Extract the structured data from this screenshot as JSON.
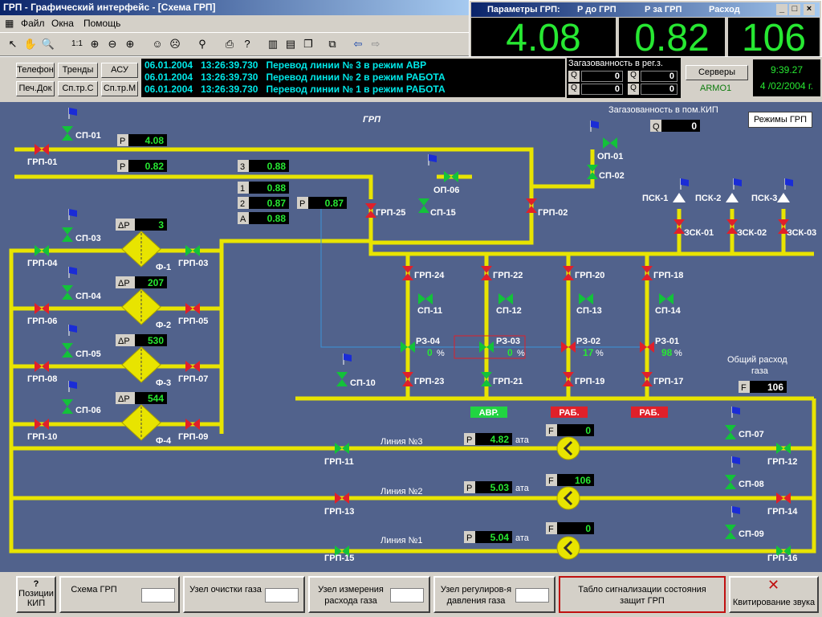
{
  "window": {
    "title": "ГРП - Графический интерфейс - [Схема ГРП]"
  },
  "menu": [
    "Файл",
    "Окна",
    "Помощь"
  ],
  "params_window": {
    "title": "Параметры ГРП:",
    "h1": "Р до ГРП",
    "h2": "Р за ГРП",
    "h3": "Расход",
    "v1": "4.08",
    "v2": "0.82",
    "v3": "106"
  },
  "side_buttons": {
    "phone": "Телефон",
    "trends": "Тренды",
    "asu": "АСУ",
    "print": "Печ.Док",
    "sptrc": "Сп.тр.С",
    "sptrm": "Сп.тр.М"
  },
  "events": [
    {
      "date": "06.01.2004",
      "time": "13:26:39.730",
      "text": "Перевод линии № 3 в режим АВР"
    },
    {
      "date": "06.01.2004",
      "time": "13:26:39.730",
      "text": "Перевод линии № 2 в режим РАБОТА"
    },
    {
      "date": "06.01.2004",
      "time": "13:26:39.730",
      "text": "Перевод линии № 1 в режим РАБОТА"
    }
  ],
  "gas": {
    "title": "Загазованность в рег.з.",
    "q": "Q",
    "vals": [
      "0",
      "0",
      "0",
      "0"
    ]
  },
  "servers": {
    "button": "Серверы",
    "node": "ARMO1"
  },
  "clock": {
    "time": "9:39.27",
    "date": "4 /02/2004 г."
  },
  "schema": {
    "title": "ГРП",
    "kip_gas_label": "Загазованность в пом.КИП",
    "kip_gas_val": "0",
    "modes_button": "Режимы ГРП",
    "p_in": "4.08",
    "p_out": "0.82",
    "p3": "0.88",
    "p1": "0.88",
    "p2": "0.87",
    "pa": "0.88",
    "p_reg": "0.87",
    "dp1": "3",
    "dp2": "207",
    "dp3": "530",
    "dp4": "544",
    "flow_label": "Общий расход газа",
    "flow_val": "106",
    "rz": [
      {
        "name": "РЗ-04",
        "pct": "0"
      },
      {
        "name": "РЗ-03",
        "pct": "0"
      },
      {
        "name": "РЗ-02",
        "pct": "17"
      },
      {
        "name": "РЗ-01",
        "pct": "98"
      }
    ],
    "status": [
      "АВР.",
      "РАБ.",
      "РАБ."
    ],
    "lines": [
      {
        "name": "Линия №3",
        "p": "4.82",
        "f": "0",
        "unit": "ата"
      },
      {
        "name": "Линия №2",
        "p": "5.03",
        "f": "106",
        "unit": "ата"
      },
      {
        "name": "Линия №1",
        "p": "5.04",
        "f": "0",
        "unit": "ата"
      }
    ]
  },
  "bottom_buttons": {
    "kip": "Позиции КИП",
    "grp": "Схема ГРП",
    "clean": "Узел очистки газа",
    "meter": "Узел измерения расхода газа",
    "reg": "Узел регулиров-я давления газа",
    "alarm": "Табло сигнализации состояния защит ГРП",
    "ack": "Квитирование звука"
  },
  "colors": {
    "pipe": "#e8e400",
    "bg": "#51628c",
    "value": "#27e832",
    "valve_open": "#13c23a",
    "valve_closed": "#e0202a"
  }
}
